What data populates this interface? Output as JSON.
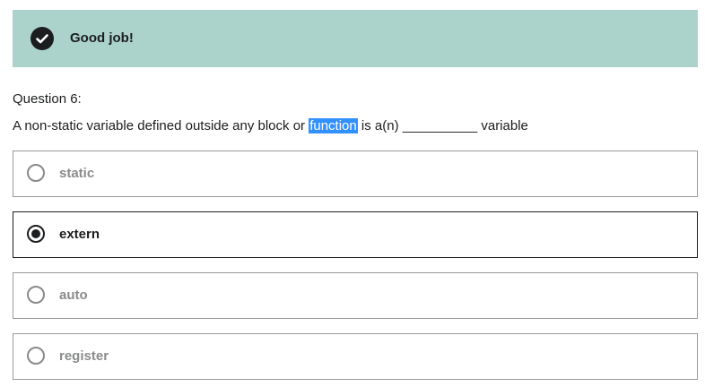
{
  "banner": {
    "message": "Good job!",
    "icon": "check-circle-icon",
    "background_color": "#acd2cc"
  },
  "question": {
    "label": "Question 6:",
    "text_before": "A non-static variable defined outside any block or ",
    "text_highlighted": "function",
    "text_after": " is a(n) __________ variable",
    "highlight_color": "#3390ff"
  },
  "options": [
    {
      "label": "static",
      "selected": false
    },
    {
      "label": "extern",
      "selected": true
    },
    {
      "label": "auto",
      "selected": false
    },
    {
      "label": "register",
      "selected": false
    }
  ]
}
